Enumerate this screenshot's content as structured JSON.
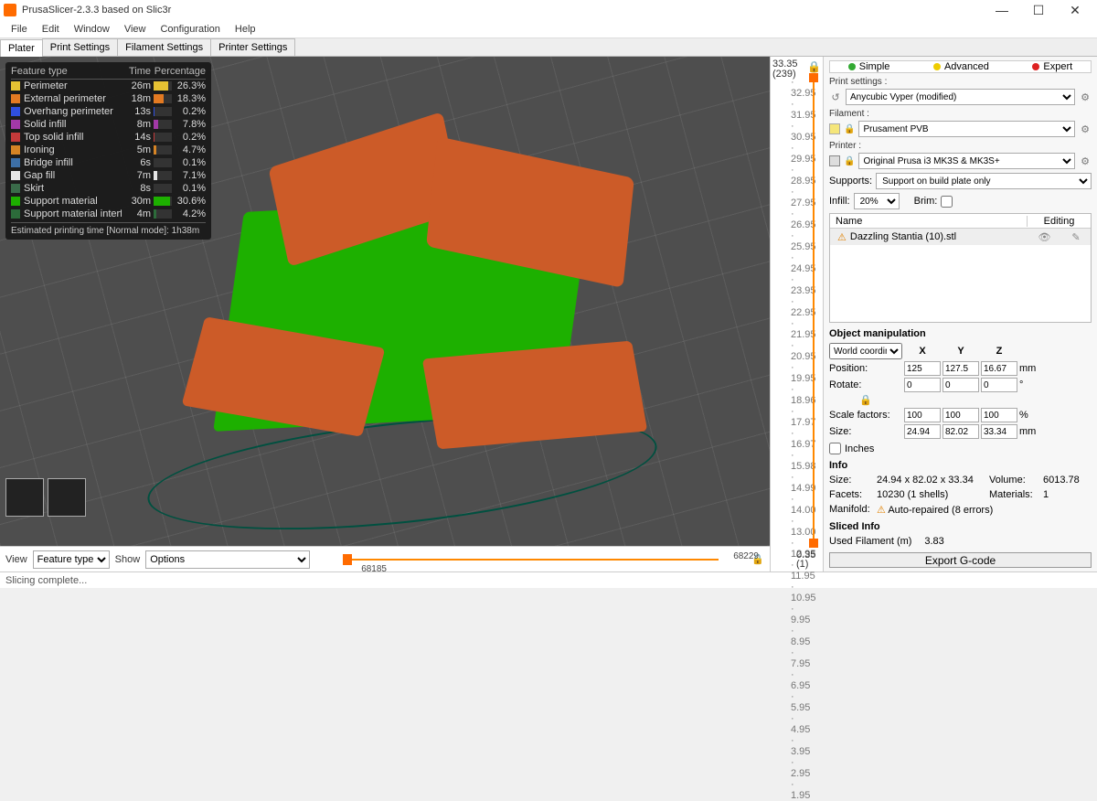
{
  "title": "PrusaSlicer-2.3.3 based on Slic3r",
  "menu": [
    "File",
    "Edit",
    "Window",
    "View",
    "Configuration",
    "Help"
  ],
  "tabs": [
    "Plater",
    "Print Settings",
    "Filament Settings",
    "Printer Settings"
  ],
  "feature_table": {
    "headers": {
      "type": "Feature type",
      "time": "Time",
      "pct": "Percentage"
    },
    "rows": [
      {
        "name": "Perimeter",
        "time": "26m",
        "pct": "26.3%",
        "color": "#e6c233"
      },
      {
        "name": "External perimeter",
        "time": "18m",
        "pct": "18.3%",
        "color": "#e37a22"
      },
      {
        "name": "Overhang perimeter",
        "time": "13s",
        "pct": "0.2%",
        "color": "#2f4fe0"
      },
      {
        "name": "Solid infill",
        "time": "8m",
        "pct": "7.8%",
        "color": "#a239a8"
      },
      {
        "name": "Top solid infill",
        "time": "14s",
        "pct": "0.2%",
        "color": "#c33a3a"
      },
      {
        "name": "Ironing",
        "time": "5m",
        "pct": "4.7%",
        "color": "#d58425"
      },
      {
        "name": "Bridge infill",
        "time": "6s",
        "pct": "0.1%",
        "color": "#3d6fa6"
      },
      {
        "name": "Gap fill",
        "time": "7m",
        "pct": "7.1%",
        "color": "#e6e6e6"
      },
      {
        "name": "Skirt",
        "time": "8s",
        "pct": "0.1%",
        "color": "#3a6b4a"
      },
      {
        "name": "Support material",
        "time": "30m",
        "pct": "30.6%",
        "color": "#1db000"
      },
      {
        "name": "Support material interface",
        "time": "4m",
        "pct": "4.2%",
        "color": "#2c6b3a"
      }
    ],
    "estimate": "Estimated printing time [Normal mode]:  1h38m"
  },
  "ruler": {
    "top": "33.35",
    "top_count": "(239)",
    "bottom": "0.35",
    "bottom_count": "(1)",
    "ticks": [
      "32.95",
      "31.95",
      "30.95",
      "29.95",
      "28.95",
      "27.95",
      "26.95",
      "25.95",
      "24.95",
      "23.95",
      "22.95",
      "21.95",
      "20.95",
      "19.95",
      "18.96",
      "17.97",
      "16.97",
      "15.98",
      "14.99",
      "14.00",
      "13.00",
      "12.95",
      "11.95",
      "10.95",
      "9.95",
      "8.95",
      "7.95",
      "6.95",
      "5.95",
      "4.95",
      "3.95",
      "2.95",
      "1.95"
    ]
  },
  "bottom": {
    "view_label": "View",
    "view_value": "Feature type",
    "show_label": "Show",
    "show_value": "Options",
    "right_num": "68229",
    "below_num": "68185"
  },
  "modes": {
    "simple": "Simple",
    "advanced": "Advanced",
    "expert": "Expert"
  },
  "print_settings": {
    "label": "Print settings :",
    "value": "Anycubic Vyper (modified)"
  },
  "filament": {
    "label": "Filament :",
    "value": "Prusament PVB"
  },
  "printer": {
    "label": "Printer :",
    "value": "Original Prusa i3 MK3S & MK3S+"
  },
  "supports": {
    "label": "Supports:",
    "value": "Support on build plate only"
  },
  "infill": {
    "label": "Infill:",
    "value": "20%",
    "brim_label": "Brim:"
  },
  "objects": {
    "name_hdr": "Name",
    "editing_hdr": "Editing",
    "item": "Dazzling Stantia (10).stl"
  },
  "manip": {
    "title": "Object manipulation",
    "coords": "World coordinates",
    "headers": {
      "x": "X",
      "y": "Y",
      "z": "Z"
    },
    "position": {
      "label": "Position:",
      "x": "125",
      "y": "127.5",
      "z": "16.67",
      "unit": "mm"
    },
    "rotate": {
      "label": "Rotate:",
      "x": "0",
      "y": "0",
      "z": "0",
      "unit": "°"
    },
    "scale": {
      "label": "Scale factors:",
      "x": "100",
      "y": "100",
      "z": "100",
      "unit": "%"
    },
    "size": {
      "label": "Size:",
      "x": "24.94",
      "y": "82.02",
      "z": "33.34",
      "unit": "mm"
    },
    "inches": "Inches"
  },
  "info": {
    "title": "Info",
    "size_l": "Size:",
    "size_v": "24.94 x 82.02 x 33.34",
    "vol_l": "Volume:",
    "vol_v": "6013.78",
    "facets_l": "Facets:",
    "facets_v": "10230 (1 shells)",
    "mat_l": "Materials:",
    "mat_v": "1",
    "manifold_l": "Manifold:",
    "manifold_v": "Auto-repaired (8 errors)"
  },
  "sliced": {
    "title": "Sliced Info",
    "used_l": "Used Filament (m)",
    "used_v": "3.83"
  },
  "export": "Export G-code",
  "status": "Slicing complete..."
}
